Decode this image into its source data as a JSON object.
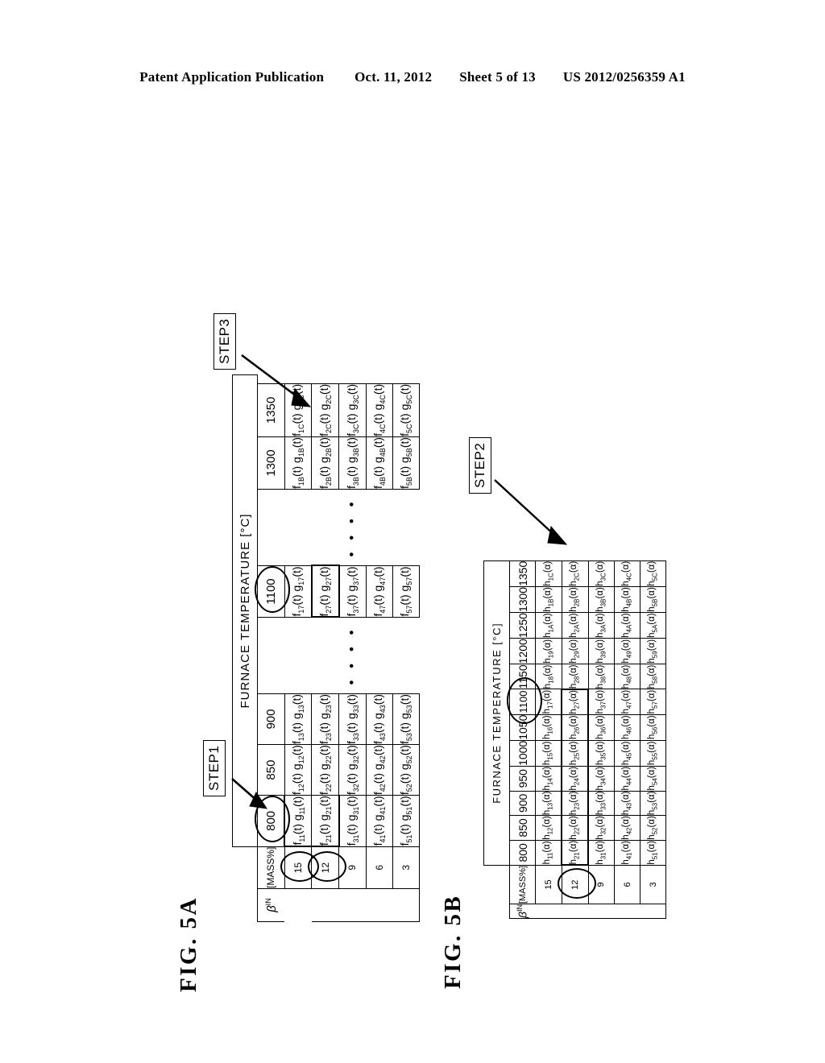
{
  "header": {
    "title": "Patent Application Publication",
    "date": "Oct. 11, 2012",
    "sheet": "Sheet 5 of 13",
    "number": "US 2012/0256359 A1"
  },
  "figures": [
    {
      "id": "fig5a",
      "label": "FIG. 5A",
      "column_header": "FURNACE TEMPERATURE  [°C]",
      "row_header_symbol": "β",
      "row_header_superscript": "IN",
      "row_header_unit": "[MASS%]",
      "row_values": [
        "15",
        "12",
        "9",
        "6",
        "3"
      ],
      "circled_row_values": [
        "15",
        "12"
      ],
      "temperature_groups": [
        "800",
        "850",
        "900",
        "1100",
        "1300",
        "1350"
      ],
      "circled_temperature": "1100",
      "ellipsis_after_groups": [
        "900",
        "1100"
      ],
      "ellipsis_glyph": "• • • •",
      "cells": {
        "800": {
          "f": [
            "f11(t)",
            "f21(t)",
            "f31(t)",
            "f41(t)",
            "f51(t)"
          ],
          "g": [
            "g11(t)",
            "g21(t)",
            "g31(t)",
            "g41(t)",
            "g51(t)"
          ]
        },
        "850": {
          "f": [
            "f12(t)",
            "f22(t)",
            "f32(t)",
            "f42(t)",
            "f52(t)"
          ],
          "g": [
            "g12(t)",
            "g22(t)",
            "g32(t)",
            "g42(t)",
            "g52(t)"
          ]
        },
        "900": {
          "f": [
            "f13(t)",
            "f23(t)",
            "f33(t)",
            "f43(t)",
            "f53(t)"
          ],
          "g": [
            "g13(t)",
            "g23(t)",
            "g33(t)",
            "g43(t)",
            "g53(t)"
          ]
        },
        "1100": {
          "f": [
            "f17(t)",
            "f27(t)",
            "f37(t)",
            "f47(t)",
            "f57(t)"
          ],
          "g": [
            "g17(t)",
            "g27(t)",
            "g37(t)",
            "g47(t)",
            "g57(t)"
          ]
        },
        "1300": {
          "f": [
            "f1B(t)",
            "f2B(t)",
            "f3B(t)",
            "f4B(t)",
            "f5B(t)"
          ],
          "g": [
            "g1B(t)",
            "g2B(t)",
            "g3B(t)",
            "g4B(t)",
            "g5B(t)"
          ]
        },
        "1350": {
          "f": [
            "f1C(t)",
            "f2C(t)",
            "f3C(t)",
            "f4C(t)",
            "f5C(t)"
          ],
          "g": [
            "g1C(t)",
            "g2C(t)",
            "g3C(t)",
            "g4C(t)",
            "g5C(t)"
          ]
        }
      },
      "annotations": [
        {
          "name": "step1",
          "label": "STEP1",
          "points_to": "column 800, row 15"
        },
        {
          "name": "step3",
          "label": "STEP3",
          "points_to": "column 1100, row 12"
        }
      ]
    },
    {
      "id": "fig5b",
      "label": "FIG. 5B",
      "column_header": "FURNACE TEMPERATURE  [°C]",
      "row_header_symbol": "β",
      "row_header_superscript": "IN",
      "row_header_unit": "[MASS%]",
      "row_values": [
        "15",
        "12",
        "9",
        "6",
        "3"
      ],
      "circled_row_values": [
        "12"
      ],
      "temperatures": [
        "800",
        "850",
        "900",
        "950",
        "1000",
        "1050",
        "1100",
        "1150",
        "1200",
        "1250",
        "1300",
        "1350"
      ],
      "circled_temperature": "1100",
      "cells": [
        [
          "h11(α)",
          "h12(α)",
          "h13(α)",
          "h14(α)",
          "h15(α)",
          "h16(α)",
          "h17(α)",
          "h18(α)",
          "h19(α)",
          "h1A(α)",
          "h1B(α)",
          "h1C(α)"
        ],
        [
          "h21(α)",
          "h22(α)",
          "h23(α)",
          "h24(α)",
          "h25(α)",
          "h26(α)",
          "h27(α)",
          "h28(α)",
          "h29(α)",
          "h2A(α)",
          "h2B(α)",
          "h2C(α)"
        ],
        [
          "h31(α)",
          "h32(α)",
          "h33(α)",
          "h34(α)",
          "h35(α)",
          "h36(α)",
          "h37(α)",
          "h38(α)",
          "h39(α)",
          "h3A(α)",
          "h3B(α)",
          "h3C(α)"
        ],
        [
          "h41(α)",
          "h42(α)",
          "h43(α)",
          "h44(α)",
          "h45(α)",
          "h46(α)",
          "h47(α)",
          "h48(α)",
          "h49(α)",
          "h4A(α)",
          "h4B(α)",
          "h4C(α)"
        ],
        [
          "h51(α)",
          "h52(α)",
          "h53(α)",
          "h54(α)",
          "h55(α)",
          "h56(α)",
          "h57(α)",
          "h58(α)",
          "h59(α)",
          "h5A(α)",
          "h5B(α)",
          "h5C(α)"
        ]
      ],
      "annotations": [
        {
          "name": "step2",
          "label": "STEP2",
          "points_to": "column 1100/1150, row 12"
        }
      ]
    }
  ]
}
